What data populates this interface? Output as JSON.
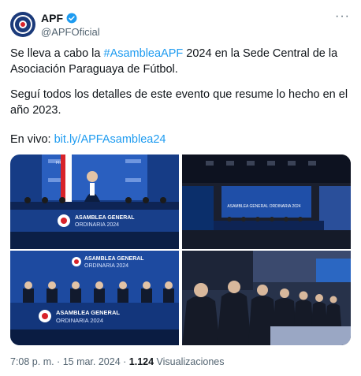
{
  "author": {
    "name": "APF",
    "handle": "@APFOficial"
  },
  "text": {
    "p1_prefix": "Se lleva a cabo la ",
    "p1_hashtag": "#AsambleaAPF",
    "p1_suffix": " 2024 en la Sede Central de la Asociación Paraguaya de Fútbol.",
    "p2": "Seguí todos los detalles de este evento que resume lo hecho en el año 2023.",
    "p3_prefix": "En vivo: ",
    "p3_link": "bit.ly/APFAsamblea24"
  },
  "photos": {
    "banner_line1": "ASAMBLEA GENERAL",
    "banner_line2": "ORDINARIA 2024",
    "wall_label": "ASAMBLEA GENERAL ORDINARIA 2024",
    "fifa": "FIFA"
  },
  "meta": {
    "time": "7:08 p. m. · 15 mar. 2024 · ",
    "views_count": "1.124",
    "views_label": " Visualizaciones"
  },
  "colors": {
    "accent": "#1d9bf0",
    "stage_blue": "#1f4fa8",
    "dark_blue": "#0f2a5c"
  }
}
